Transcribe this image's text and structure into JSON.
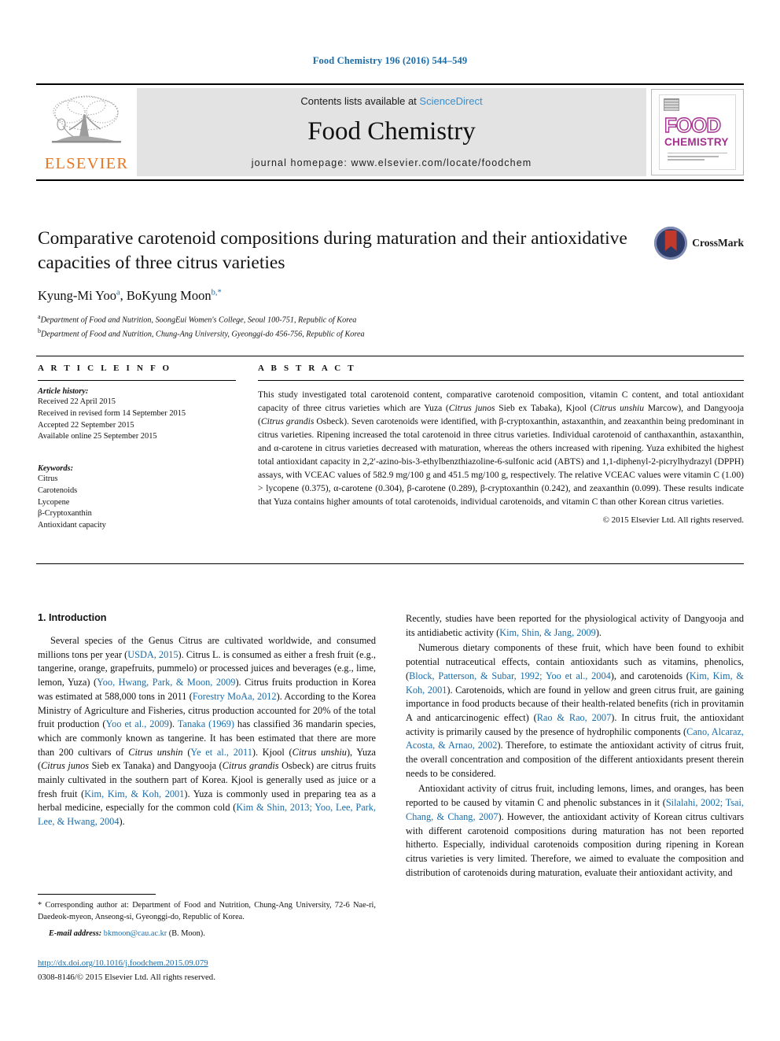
{
  "running_head": "Food Chemistry 196 (2016) 544–549",
  "masthead": {
    "contents_prefix": "Contents lists available at ",
    "sciencedirect": "ScienceDirect",
    "journal_title": "Food Chemistry",
    "homepage": "journal homepage: www.elsevier.com/locate/foodchem",
    "publisher_wordmark": "ELSEVIER",
    "cover": {
      "line1": "FOOD",
      "line2": "CHEMISTRY"
    },
    "accent_blue": "#3a8fcf",
    "elsevier_orange": "#e87722",
    "cover_magenta": "#a3308f"
  },
  "article": {
    "title": "Comparative carotenoid compositions during maturation and their antioxidative capacities of three citrus varieties",
    "authors": "Kyung-Mi Yoo",
    "author_sup_a": "a",
    "author2": ", BoKyung Moon",
    "author_sup_b": "b,*",
    "affiliation_a_sup": "a",
    "affiliation_a": "Department of Food and Nutrition, SoongEui Women's College, Seoul 100-751, Republic of Korea",
    "affiliation_b_sup": "b",
    "affiliation_b": "Department of Food and Nutrition, Chung-Ang University, Gyeonggi-do 456-756, Republic of Korea",
    "crossmark_label": "CrossMark"
  },
  "info": {
    "heading": "A R T I C L E  I N F O",
    "history_label": "Article history:",
    "history": [
      "Received 22 April 2015",
      "Received in revised form 14 September 2015",
      "Accepted 22 September 2015",
      "Available online 25 September 2015"
    ],
    "keywords_label": "Keywords:",
    "keywords": [
      "Citrus",
      "Carotenoids",
      "Lycopene",
      "β-Cryptoxanthin",
      "Antioxidant capacity"
    ]
  },
  "abstract": {
    "heading": "A B S T R A C T",
    "text_part1": "This study investigated total carotenoid content, comparative carotenoid composition, vitamin C content, and total antioxidant capacity of three citrus varieties which are Yuza (",
    "sp1": "Citrus junos",
    "text_part2": " Sieb ex Tabaka), Kjool (",
    "sp2": "Citrus unshiu",
    "text_part3": " Marcow), and Dangyooja (",
    "sp3": "Citrus grandis",
    "text_part4": " Osbeck). Seven carotenoids were identified, with β-cryptoxanthin, astaxanthin, and zeaxanthin being predominant in citrus varieties. Ripening increased the total carotenoid in three citrus varieties. Individual carotenoid of canthaxanthin, astaxanthin, and α-carotene in citrus varieties decreased with maturation, whereas the others increased with ripening. Yuza exhibited the highest total antioxidant capacity in 2,2′-azino-bis-3-ethylbenzthiazoline-6-sulfonic acid (ABTS) and 1,1-diphenyl-2-picrylhydrazyl (DPPH) assays, with VCEAC values of 582.9 mg/100 g and 451.5 mg/100 g, respectively. The relative VCEAC values were vitamin C (1.00) > lycopene (0.375), α-carotene (0.304), β-carotene (0.289), β-cryptoxanthin (0.242), and zeaxanthin (0.099). These results indicate that Yuza contains higher amounts of total carotenoids, individual carotenoids, and vitamin C than other Korean citrus varieties.",
    "copyright": "© 2015 Elsevier Ltd. All rights reserved."
  },
  "body": {
    "section1_heading": "1. Introduction",
    "left": {
      "p1_a": "Several species of the Genus Citrus are cultivated worldwide, and consumed millions tons per year (",
      "p1_c1": "USDA, 2015",
      "p1_b": "). Citrus L. is consumed as either a fresh fruit (e.g., tangerine, orange, grapefruits, pummelo) or processed juices and beverages (e.g., lime, lemon, Yuza) (",
      "p1_c2": "Yoo, Hwang, Park, & Moon, 2009",
      "p1_c": "). Citrus fruits production in Korea was estimated at 588,000 tons in 2011 (",
      "p1_c3": "Forestry MoAa, 2012",
      "p1_d": "). According to the Korea Ministry of Agriculture and Fisheries, citrus production accounted for 20% of the total fruit production (",
      "p1_c4": "Yoo et al., 2009",
      "p1_e": "). ",
      "p1_c5": "Tanaka (1969)",
      "p1_f": " has classified 36 mandarin species, which are commonly known as tangerine. It has been estimated that there are more than 200 cultivars of ",
      "p1_sp1": "Citrus unshin",
      "p1_g": " (",
      "p1_c6": "Ye et al., 2011",
      "p1_h": "). Kjool (",
      "p1_sp2": "Citrus unshiu",
      "p1_i": "), Yuza (",
      "p1_sp3": "Citrus junos",
      "p1_j": " Sieb ex Tanaka) and Dangyooja (",
      "p1_sp4": "Citrus grandis",
      "p1_k": " Osbeck) are citrus fruits mainly cultivated in the southern part of Korea. Kjool is generally used as juice or a fresh fruit (",
      "p1_c7": "Kim, Kim, & Koh, 2001",
      "p1_l": "). Yuza is commonly used in preparing tea as a herbal medicine, especially for the common cold (",
      "p1_c8": "Kim & Shin, 2013; Yoo, Lee, Park, Lee, & Hwang, 2004",
      "p1_m": ")."
    },
    "right": {
      "p2_a": "Recently, studies have been reported for the physiological activity of Dangyooja and its antidiabetic activity (",
      "p2_c1": "Kim, Shin, & Jang, 2009",
      "p2_b": ").",
      "p3_a": "Numerous dietary components of these fruit, which have been found to exhibit potential nutraceutical effects, contain antioxidants such as vitamins, phenolics, (",
      "p3_c1": "Block, Patterson, & Subar, 1992; Yoo et al., 2004",
      "p3_b": "), and carotenoids (",
      "p3_c2": "Kim, Kim, & Koh, 2001",
      "p3_c": "). Carotenoids, which are found in yellow and green citrus fruit, are gaining importance in food products because of their health-related benefits (rich in provitamin A and anticarcinogenic effect) (",
      "p3_c3": "Rao & Rao, 2007",
      "p3_d": "). In citrus fruit, the antioxidant activity is primarily caused by the presence of hydrophilic components (",
      "p3_c4": "Cano, Alcaraz, Acosta, & Arnao, 2002",
      "p3_e": "). Therefore, to estimate the antioxidant activity of citrus fruit, the overall concentration and composition of the different antioxidants present therein needs to be considered.",
      "p4_a": "Antioxidant activity of citrus fruit, including lemons, limes, and oranges, has been reported to be caused by vitamin C and phenolic substances in it (",
      "p4_c1": "Silalahi, 2002; Tsai, Chang, & Chang, 2007",
      "p4_b": "). However, the antioxidant activity of Korean citrus cultivars with different carotenoid compositions during maturation has not been reported hitherto. Especially, individual carotenoids composition during ripening in Korean citrus varieties is very limited. Therefore, we aimed to evaluate the composition and distribution of carotenoids during maturation, evaluate their antioxidant activity, and"
    }
  },
  "footer": {
    "corresponding": "* Corresponding author at: Department of Food and Nutrition, Chung-Ang University, 72-6 Nae-ri, Daedeok-myeon, Anseong-si, Gyeonggi-do, Republic of Korea.",
    "email_label": "E-mail address:",
    "email": "bkmoon@cau.ac.kr",
    "email_suffix": " (B. Moon).",
    "doi": "http://dx.doi.org/10.1016/j.foodchem.2015.09.079",
    "issn": "0308-8146/© 2015 Elsevier Ltd. All rights reserved."
  }
}
